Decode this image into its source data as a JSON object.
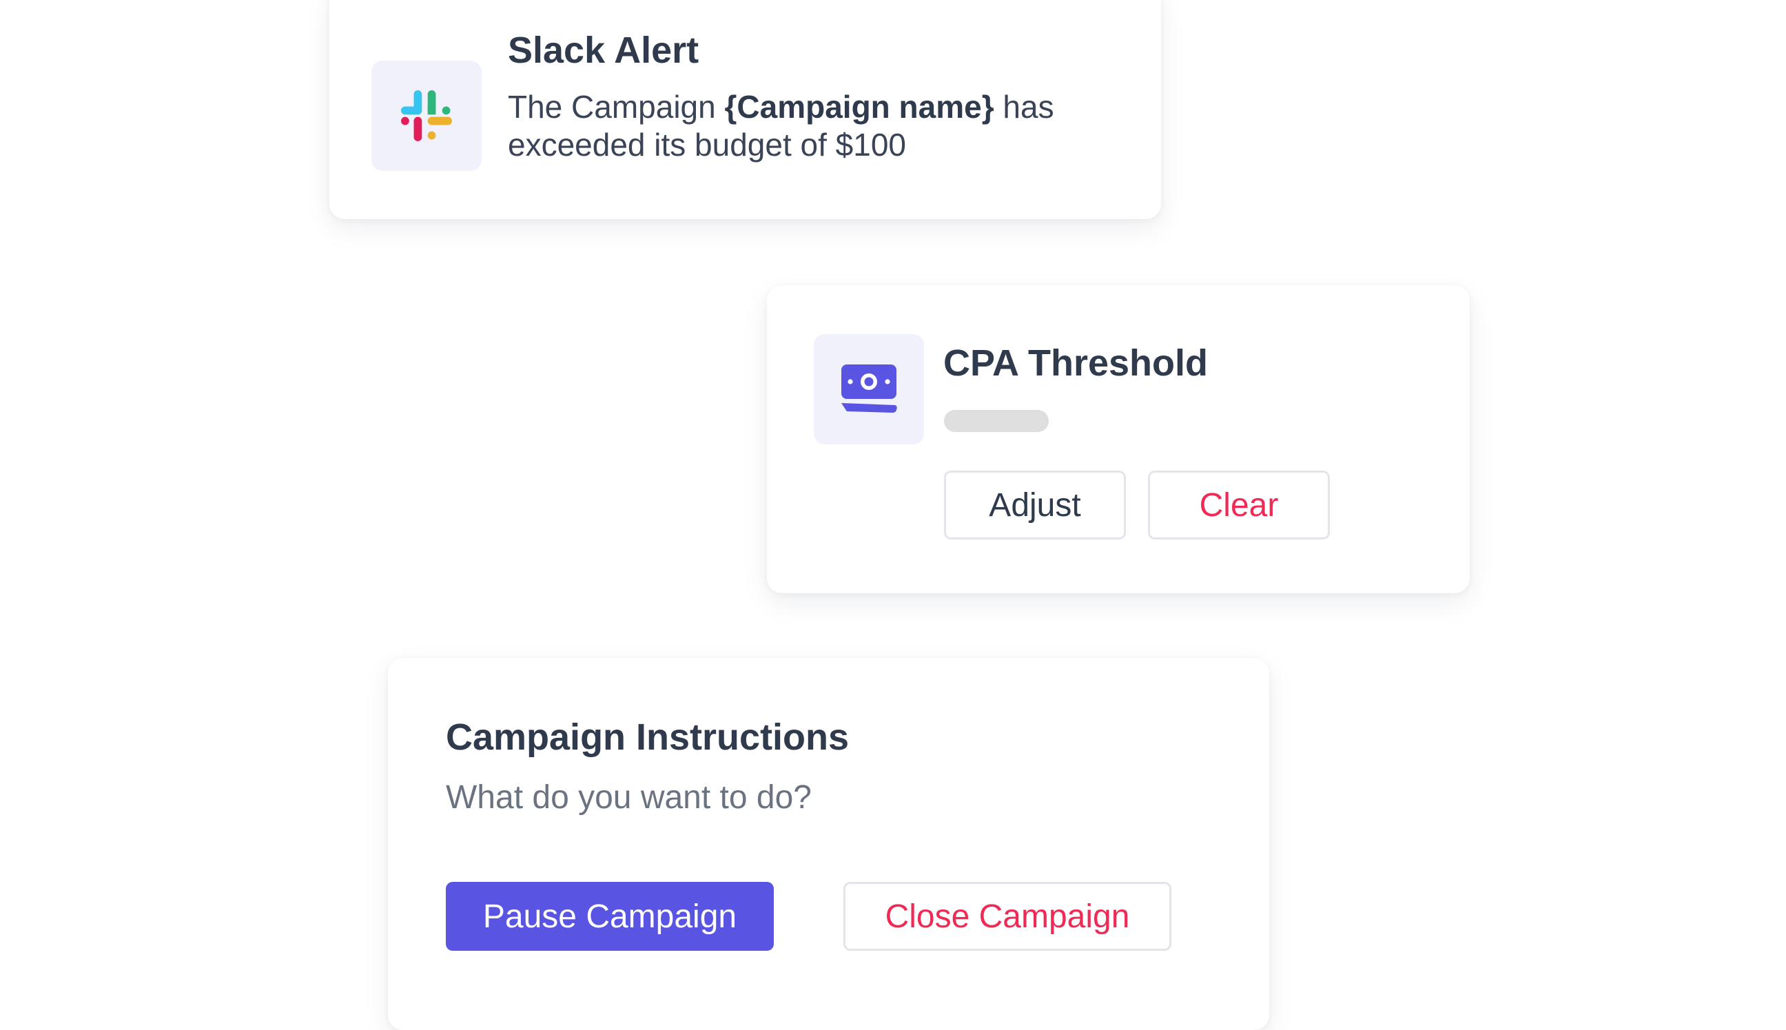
{
  "slack_alert": {
    "title": "Slack Alert",
    "message_prefix": "The Campaign ",
    "message_bold": "{Campaign name}",
    "message_suffix": " has exceeded its budget of $100",
    "icon": "slack-logo-icon",
    "icon_colors": [
      "#36c5f0",
      "#2eb67d",
      "#ecb22e",
      "#e01e5a"
    ]
  },
  "cpa_threshold": {
    "title": "CPA Threshold",
    "icon": "money-bill-icon",
    "icon_color": "#5a54e3",
    "adjust_label": "Adjust",
    "clear_label": "Clear"
  },
  "campaign_instructions": {
    "title": "Campaign Instructions",
    "prompt": "What do you want to do?",
    "pause_label": "Pause Campaign",
    "close_label": "Close Campaign"
  },
  "colors": {
    "accent": "#5a54e3",
    "danger": "#ee2a55",
    "text": "#2f3a4d",
    "muted": "#6b7280",
    "tile_bg": "#f1f1fb"
  }
}
